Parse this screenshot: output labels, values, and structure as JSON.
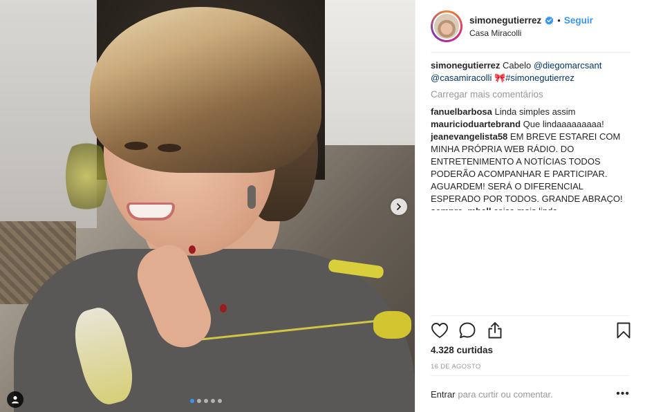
{
  "header": {
    "username": "simonegutierrez",
    "bullet": "•",
    "follow_label": "Seguir",
    "location": "Casa Miracolli"
  },
  "caption": {
    "username": "simonegutierrez",
    "text_before": " Cabelo ",
    "mention1": "@diegomarcsant",
    "mention2": "@casamiracolli",
    "emoji": " 🎀",
    "hashtag": "#simonegutierrez"
  },
  "load_more_label": "Carregar mais comentários",
  "comments": [
    {
      "username": "fanuelbarbosa",
      "text": " Linda simples assim"
    },
    {
      "username": "mauricioduartebrand",
      "text": " Que lindaaaaaaaaa!"
    },
    {
      "username": "jeanevangelista58",
      "text": " EM BREVE ESTAREI COM MINHA PRÓPRIA WEB RÁDIO. DO ENTRETENIMENTO A NOTÍCIAS TODOS PODERÃO ACOMPANHAR E PARTICIPAR. AGUARDEM! SERÁ O DIFERENCIAL ESPERADO POR TODOS. GRANDE ABRAÇO!"
    },
    {
      "username": "sempre_mhell",
      "text": " coisa mais linda"
    }
  ],
  "likes_text": "4.328 curtidas",
  "date_text": "16 DE AGOSTO",
  "comment_box": {
    "login_label": "Entrar",
    "hint": "para curtir ou comentar.",
    "more_label": "•••"
  },
  "carousel": {
    "total": 5,
    "active_index": 0
  },
  "icons": {
    "heart": "heart-icon",
    "comment": "comment-icon",
    "share": "share-icon",
    "save": "bookmark-icon",
    "next": "chevron-right-icon",
    "tag": "user-tag-icon",
    "verified": "verified-badge-icon"
  },
  "colors": {
    "link_blue": "#3897f0",
    "mention": "#003569",
    "muted": "#999999",
    "text": "#262626"
  }
}
